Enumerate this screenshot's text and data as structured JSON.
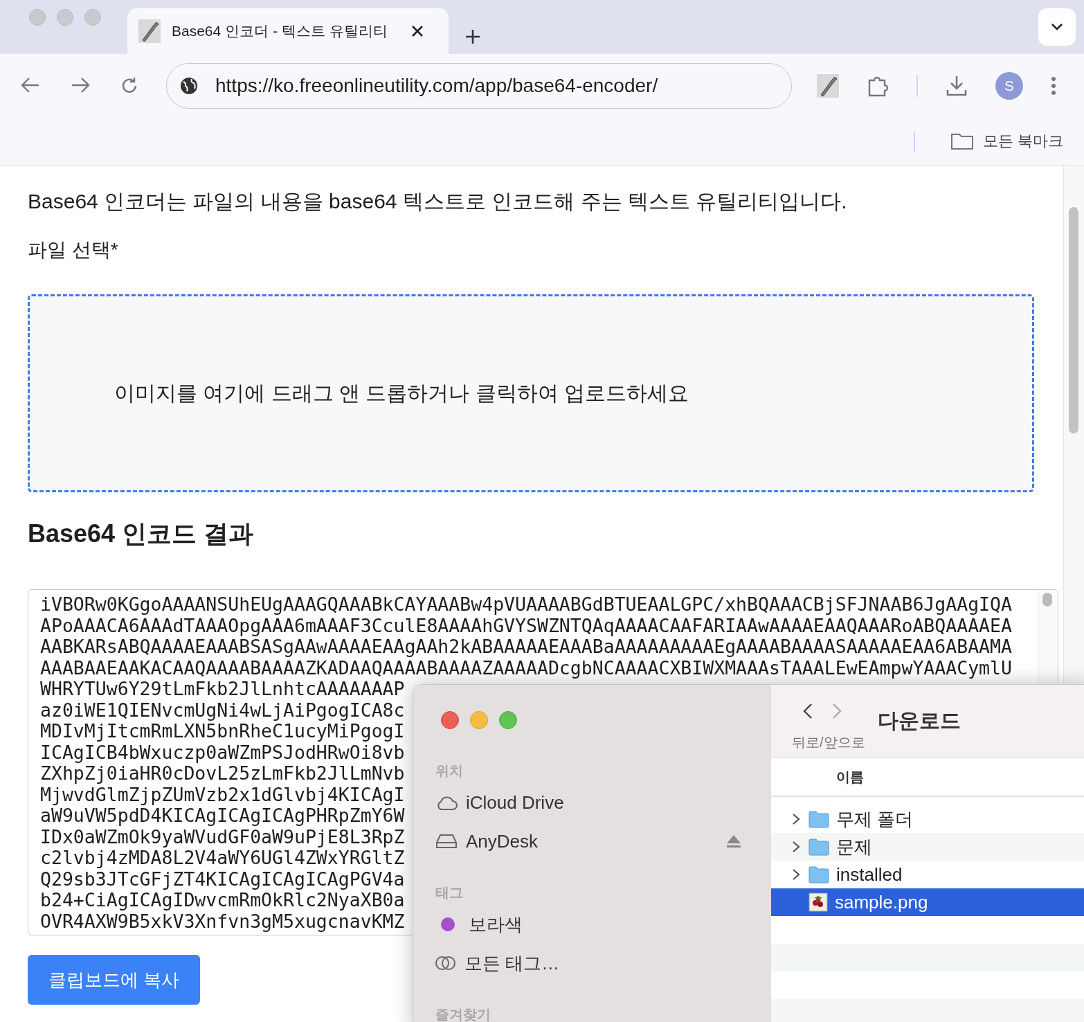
{
  "browser": {
    "tab": {
      "title": "Base64 인코더 - 텍스트 유틸리티",
      "selected": true
    },
    "address": {
      "url": "https://ko.freeonlineutility.com/app/base64-encoder/"
    },
    "profile": {
      "initial": "S"
    },
    "bookmarks": {
      "label": "모든 북마크"
    }
  },
  "page": {
    "description": "Base64 인코더는 파일의 내용을 base64 텍스트로 인코드해 주는 텍스트 유틸리티입니다.",
    "file_label": "파일 선택*",
    "dropzone": {
      "text": "이미지를 여기에 드래그 앤 드롭하거나 클릭하여 업로드하세요"
    },
    "result_heading": "Base64 인코드 결과",
    "result_lines": [
      "iVBORw0KGgoAAAANSUhEUgAAAGQAAABkCAYAAABw4pVUAAAABGdBTUEAALGPC/xhBQAAACBjSFJNAAB6JgAAgIQA",
      "APoAAACA6AAAdTAAAOpgAAA6mAAAF3CculE8AAAAhGVYSWZNTQAqAAAACAAFARIAAwAAAAEAAQAAARoABQAAAAEA",
      "AABKARsABQAAAAEAAABSASgAAwAAAAEAAgAAh2kABAAAAAEAAABaAAAAAAAAAEgAAAABAAAASAAAAAEAA6ABAAMA",
      "AAABAAEAAKACAAQAAAABAAAAZKADAAQAAAABAAAAZAAAAADcgbNCAAAACXBIWXMAAAsTAAALEwEAmpwYAAACymlU",
      "WHRYTUw6Y29tLmFkb2JlLnhtcAAAAAAAP",
      "az0iWE1QIENvcmUgNi4wLjAiPgogICA8c",
      "MDIvMjItcmRmLXN5bnRheC1ucyMiPgogI",
      "ICAgICB4bWxuczp0aWZmPSJodHRwOi8vb",
      "ZXhpZj0iaHR0cDovL25zLmFkb2JlLmNvb",
      "MjwvdGlmZjpZUmVzb2x1dGlvbj4KICAgI",
      "aW9uVW5pdD4KICAgICAgICAgPHRpZmY6W",
      "IDx0aWZmOk9yaWVudGF0aW9uPjE8L3RpZ",
      "c2lvbj4zMDA8L2V4aWY6UGl4ZWxYRGltZ",
      "Q29sb3JTcGFjZT4KICAgICAgICAgPGV4a",
      "b24+CiAgICAgIDwvcmRmOkRlc2NyaXB0a",
      "OVR4AXW9B5xkV3Xnfvn3gM5xugcnavKMZ"
    ],
    "copy_button": "클립보드에 복사"
  },
  "dialog": {
    "folder": "다운로드",
    "nav_label": "뒤로/앞으로",
    "column": "이름",
    "sidebar": [
      {
        "heading": "위치",
        "items": [
          {
            "kind": "cloud",
            "label": "iCloud Drive"
          },
          {
            "kind": "disk",
            "label": "AnyDesk"
          }
        ]
      },
      {
        "heading": "태그",
        "items": [
          {
            "kind": "tag",
            "label": "보라색",
            "color": "#a64fcf"
          },
          {
            "kind": "all-tags",
            "label": "모든 태그…"
          }
        ]
      },
      {
        "heading": "즐겨찾기"
      }
    ],
    "files": [
      {
        "kind": "folder",
        "name": "무제 폴더",
        "selected": false
      },
      {
        "kind": "folder",
        "name": "문제",
        "selected": false
      },
      {
        "kind": "folder",
        "name": "installed",
        "selected": false
      },
      {
        "kind": "image",
        "name": "sample.png",
        "selected": true
      }
    ]
  }
}
